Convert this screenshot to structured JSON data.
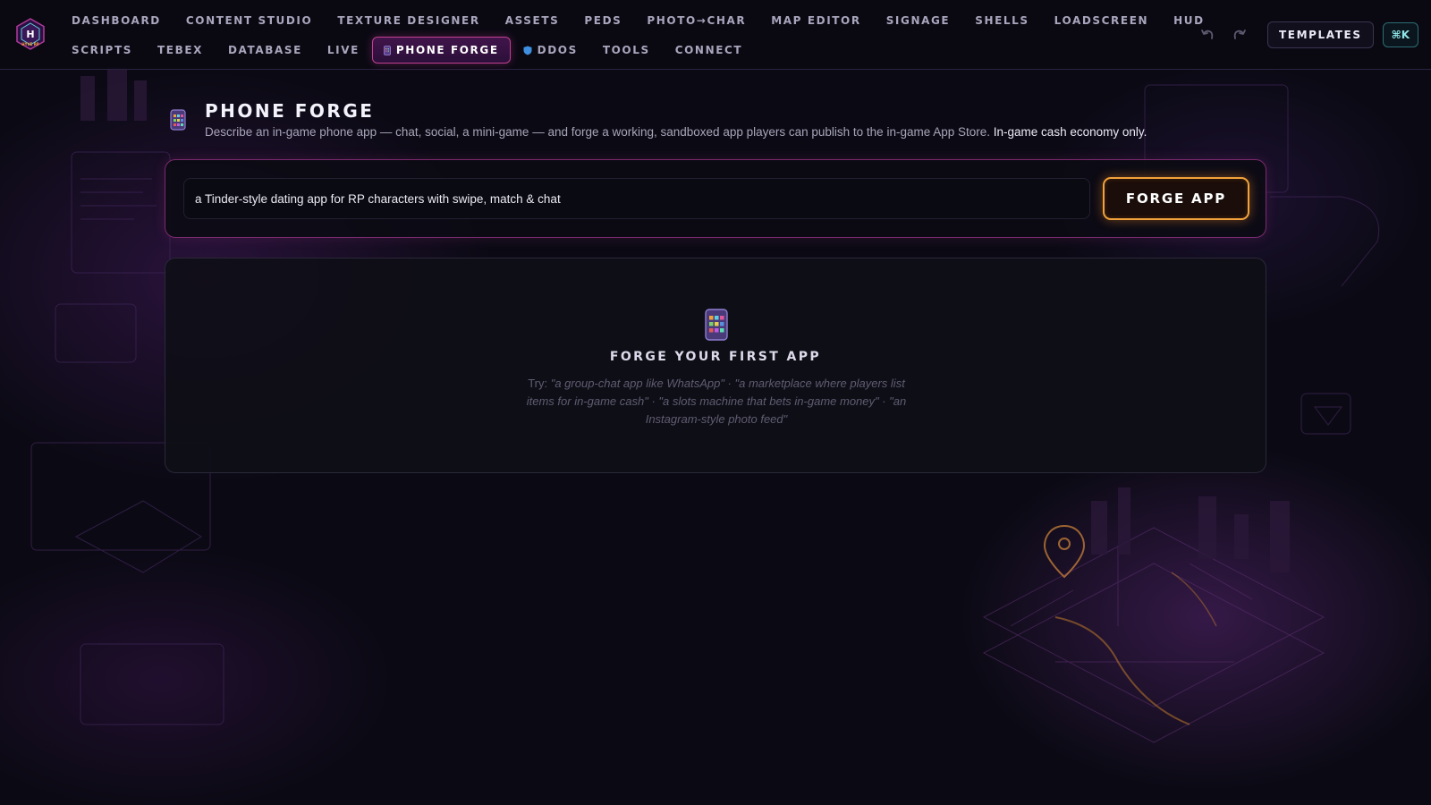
{
  "brand": {
    "logo_text": "HYVE RP"
  },
  "nav": {
    "row1": [
      {
        "label": "DASHBOARD"
      },
      {
        "label": "CONTENT STUDIO"
      },
      {
        "label": "TEXTURE DESIGNER"
      },
      {
        "label": "ASSETS"
      },
      {
        "label": "PEDS"
      },
      {
        "label": "PHOTO→CHAR"
      },
      {
        "label": "MAP EDITOR"
      },
      {
        "label": "SIGNAGE"
      },
      {
        "label": "SHELLS"
      },
      {
        "label": "LOADSCREEN"
      },
      {
        "label": "HUD"
      }
    ],
    "row2": [
      {
        "label": "SCRIPTS"
      },
      {
        "label": "TEBEX"
      },
      {
        "label": "DATABASE"
      },
      {
        "label": "LIVE"
      },
      {
        "label": "PHONE FORGE",
        "icon": "phone-icon",
        "active": true
      },
      {
        "label": "DDOS",
        "icon": "shield-icon"
      },
      {
        "label": "TOOLS"
      },
      {
        "label": "CONNECT"
      }
    ]
  },
  "toolbar": {
    "undo_icon": "undo-icon",
    "redo_icon": "redo-icon",
    "templates_label": "TEMPLATES",
    "command_label": "⌘K"
  },
  "header": {
    "icon": "phone-icon",
    "title": "PHONE FORGE",
    "description": "Describe an in-game phone app — chat, social, a mini-game — and forge a working, sandboxed app players can publish to the in-game App Store.",
    "description_emphasis": "In-game cash economy only."
  },
  "prompt": {
    "value": "a Tinder-style dating app for RP characters with swipe, match & chat",
    "button_label": "FORGE APP"
  },
  "empty_state": {
    "icon": "phone-icon",
    "title": "FORGE YOUR FIRST APP",
    "try_label": "Try:",
    "examples": "\"a group-chat app like WhatsApp\" · \"a marketplace where players list items for in-game cash\" · \"a slots machine that bets in-game money\" · \"an Instagram-style photo feed\""
  },
  "colors": {
    "accent_pink": "#c0408f",
    "accent_orange": "#f2a23a",
    "accent_cyan": "#8fe3e6",
    "background": "#0b0a14"
  }
}
